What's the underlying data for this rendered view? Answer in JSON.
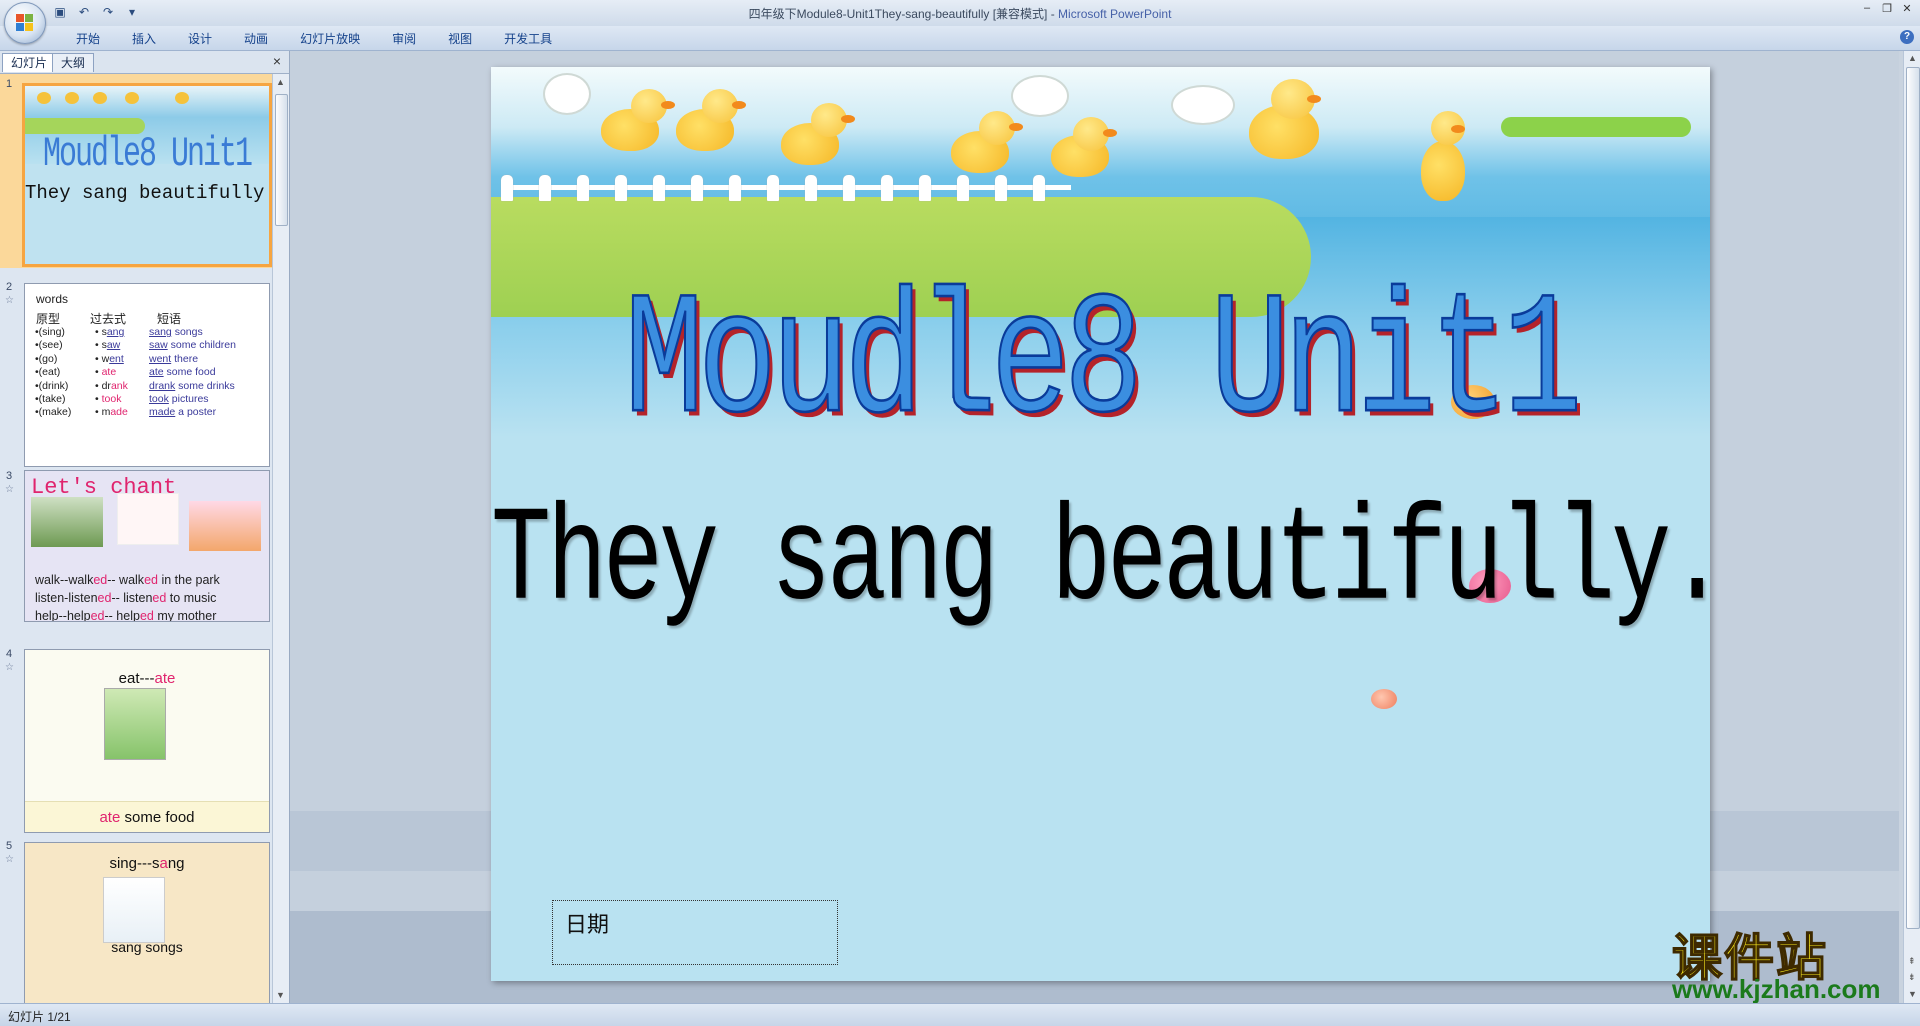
{
  "app": {
    "title_doc": "四年级下Module8-Unit1They-sang-beautifully [兼容模式] - ",
    "title_app": "Microsoft PowerPoint"
  },
  "ribbon": {
    "tabs": [
      "开始",
      "插入",
      "设计",
      "动画",
      "幻灯片放映",
      "审阅",
      "视图",
      "开发工具"
    ]
  },
  "panel": {
    "tab_slides": "幻灯片",
    "tab_outline": "大纲",
    "close": "×"
  },
  "thumbs": {
    "s1": {
      "num": "1",
      "title": "Moudle8 Unit1",
      "subtitle": "They sang beautifully."
    },
    "s2": {
      "num": "2",
      "words": "words",
      "h_base": "原型",
      "h_past": "过去式",
      "h_phrase": "短语",
      "base": [
        "•(sing)",
        "•(see)",
        "•(go)",
        "•(eat)",
        "•(drink)",
        "•(take)",
        "•(make)"
      ],
      "past_pre": [
        "• s",
        "• s",
        "• w",
        "• ",
        "• dr",
        "• ",
        "• m"
      ],
      "past_hl": [
        "ang",
        "aw",
        "ent",
        "ate",
        "ank",
        "took",
        "ade"
      ],
      "phrase_verb": [
        "sang",
        "saw",
        "went",
        "ate",
        "drank",
        "took",
        "made"
      ],
      "phrase_rest": [
        " songs",
        " some children",
        " there",
        " some food",
        " some drinks",
        " pictures",
        " a poster"
      ]
    },
    "s3": {
      "num": "3",
      "title": "Let's chant",
      "l1a": "walk--walk",
      "l1b": "ed",
      "l1c": "-- walk",
      "l1d": "ed",
      "l1e": " in the park",
      "l2a": "listen-listen",
      "l2b": "ed",
      "l2c": "-- listen",
      "l2d": "ed",
      "l2e": " to music",
      "l3a": "help--help",
      "l3b": "ed",
      "l3c": "-- help",
      "l3d": "ed",
      "l3e": " my mother"
    },
    "s4": {
      "num": "4",
      "h1": "eat---",
      "h2": "ate",
      "f1": "ate",
      "f2": " some food"
    },
    "s5": {
      "num": "5",
      "h1": "sing---s",
      "h2": "a",
      "h3": "ng",
      "f1": "sang songs"
    }
  },
  "slide": {
    "title": "Moudle8 Unit1",
    "subtitle": "They sang beautifully.",
    "date_placeholder": "日期"
  },
  "watermark": {
    "cn": "课件站",
    "url": "www.kjzhan.com"
  },
  "status": {
    "slide_info": "幻灯片 1/21"
  }
}
